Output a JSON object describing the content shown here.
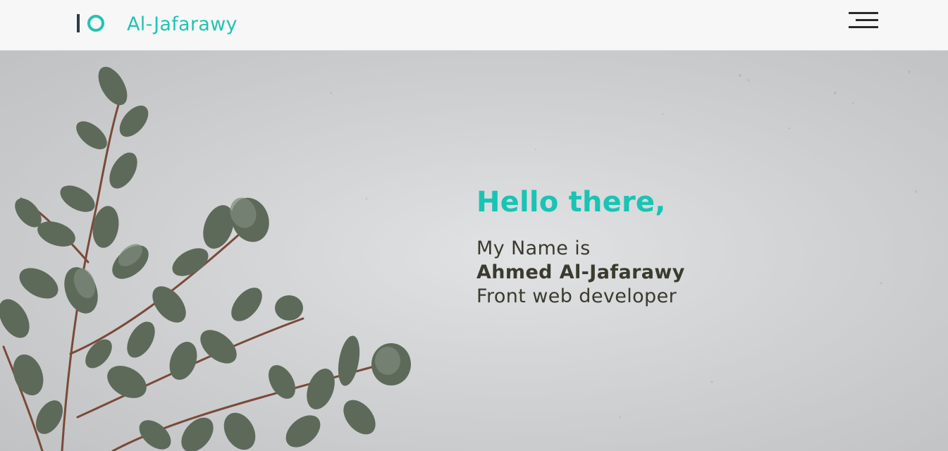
{
  "header": {
    "brand_name": "Al-Jafarawy",
    "logo_icon": "io-logo-icon",
    "menu_icon": "hamburger-menu-icon"
  },
  "hero": {
    "greeting": "Hello there,",
    "intro_line": "My Name is",
    "name": "Ahmed Al-Jafarawy",
    "role": "Front web developer",
    "background": "concrete texture with eucalyptus branch"
  },
  "colors": {
    "accent": "#1fc5b4",
    "text_dark": "#3a3a2e",
    "logo_dark": "#2d3a45",
    "navbar_bg": "#f7f7f7"
  }
}
